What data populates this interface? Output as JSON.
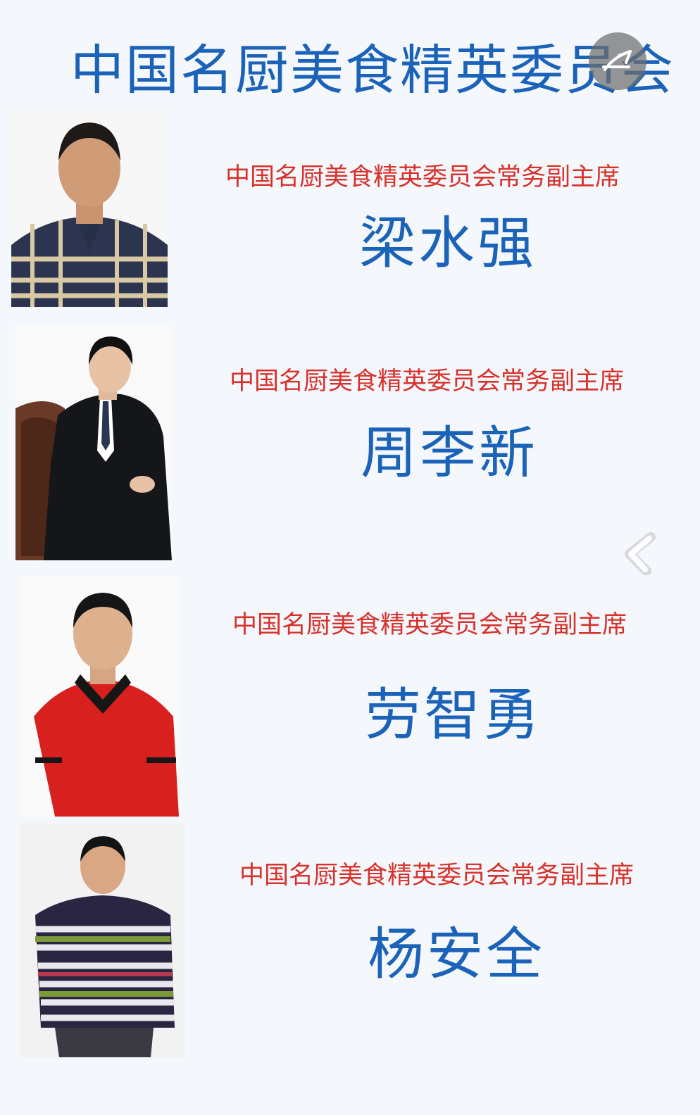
{
  "header": {
    "title": "中国名厨美食精英委员会"
  },
  "overlay": {
    "icon": "expand-icon",
    "edge_icon": "chevron-left-icon"
  },
  "members": [
    {
      "role": "中国名厨美食精英委员会常务副主席",
      "name": "梁水强"
    },
    {
      "role": "中国名厨美食精英委员会常务副主席",
      "name": "周李新"
    },
    {
      "role": "中国名厨美食精英委员会常务副主席",
      "name": "劳智勇"
    },
    {
      "role": "中国名厨美食精英委员会常务副主席",
      "name": "杨安全"
    }
  ],
  "colors": {
    "title": "#1b63b8",
    "role": "#d8322c",
    "background": "#f4f7fb"
  }
}
